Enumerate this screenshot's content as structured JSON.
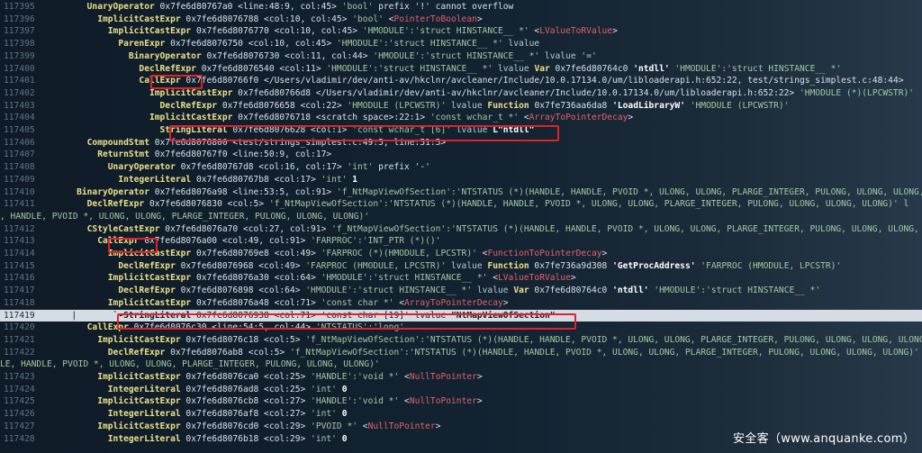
{
  "lines": [
    {
      "n": "117395",
      "segs": [
        [
          "      ",
          "tree"
        ],
        [
          "UnaryOperator",
          "yellow"
        ],
        [
          " 0x7fe6d80767a0 <line:48:9, col:45> ",
          "white"
        ],
        [
          "'bool'",
          "green"
        ],
        [
          " prefix '!' cannot overflow",
          "white"
        ]
      ]
    },
    {
      "n": "117396",
      "segs": [
        [
          "        ",
          "tree"
        ],
        [
          "ImplicitCastExpr",
          "yellow"
        ],
        [
          " 0x7fe6d8076788 <col:10, col:45> ",
          "white"
        ],
        [
          "'bool'",
          "green"
        ],
        [
          " <",
          "white"
        ],
        [
          "PointerToBoolean",
          "red"
        ],
        [
          ">",
          "white"
        ]
      ]
    },
    {
      "n": "117397",
      "segs": [
        [
          "          ",
          "tree"
        ],
        [
          "ImplicitCastExpr",
          "yellow"
        ],
        [
          " 0x7fe6d8076770 <col:10, col:45> ",
          "white"
        ],
        [
          "'HMODULE':'struct HINSTANCE__ *'",
          "green"
        ],
        [
          " <",
          "white"
        ],
        [
          "LValueToRValue",
          "red"
        ],
        [
          ">",
          "white"
        ]
      ]
    },
    {
      "n": "117398",
      "segs": [
        [
          "            ",
          "tree"
        ],
        [
          "ParenExpr",
          "yellow"
        ],
        [
          " 0x7fe6d8076750 <col:10, col:45> ",
          "white"
        ],
        [
          "'HMODULE':'struct HINSTANCE__ *'",
          "green"
        ],
        [
          " lvalue",
          "cyan"
        ]
      ]
    },
    {
      "n": "117399",
      "segs": [
        [
          "              ",
          "tree"
        ],
        [
          "BinaryOperator",
          "yellow"
        ],
        [
          " 0x7fe6d8076730 <col:11, col:44> ",
          "white"
        ],
        [
          "'HMODULE':'struct HINSTANCE__ *'",
          "green"
        ],
        [
          " lvalue '='",
          "cyan"
        ]
      ]
    },
    {
      "n": "117400",
      "segs": [
        [
          "                ",
          "tree"
        ],
        [
          "DeclRefExpr",
          "yellow"
        ],
        [
          " 0x7fe6d8076540 <col:11> ",
          "white"
        ],
        [
          "'HMODULE':'struct HINSTANCE__ *'",
          "green"
        ],
        [
          " lvalue ",
          "cyan"
        ],
        [
          "Var",
          "yellow"
        ],
        [
          " 0x7fe6d80764c0 ",
          "white"
        ],
        [
          "'ntdll'",
          "bwhite"
        ],
        [
          " 'HMODULE':'struct HINSTANCE__ *'",
          "green"
        ]
      ]
    },
    {
      "n": "117401",
      "segs": [
        [
          "                ",
          "tree"
        ],
        [
          "CallExpr",
          "yellow"
        ],
        [
          " 0x7fe6d80766f0 </Users/vladimir/dev/anti-av/hkclnr/avcleaner/Include/10.0.17134.0/um/libloaderapi.h:652:22, test/strings_simplest.c:48:44>",
          "white"
        ]
      ]
    },
    {
      "n": "117402",
      "segs": [
        [
          "                  ",
          "tree"
        ],
        [
          "ImplicitCastExpr",
          "yellow"
        ],
        [
          " 0x7fe6d80766d8 </Users/vladimir/dev/anti-av/hkclnr/avcleaner/Include/10.0.17134.0/um/libloaderapi.h:652:22> ",
          "white"
        ],
        [
          "'HMODULE (*)(LPCWSTR)'",
          "green"
        ]
      ]
    },
    {
      "n": "117403",
      "segs": [
        [
          "                    ",
          "tree"
        ],
        [
          "DeclRefExpr",
          "yellow"
        ],
        [
          " 0x7fe6d8076658 <col:22> ",
          "white"
        ],
        [
          "'HMODULE (LPCWSTR)'",
          "green"
        ],
        [
          " lvalue ",
          "cyan"
        ],
        [
          "Function",
          "yellow"
        ],
        [
          " 0x7fe736aa6da8 ",
          "white"
        ],
        [
          "'LoadLibraryW'",
          "bwhite"
        ],
        [
          " 'HMODULE (LPCWSTR)'",
          "green"
        ]
      ]
    },
    {
      "n": "117404",
      "segs": [
        [
          "                  ",
          "tree"
        ],
        [
          "ImplicitCastExpr",
          "yellow"
        ],
        [
          " 0x7fe6d8076718 <scratch space>:22:1> ",
          "white"
        ],
        [
          "'const wchar_t *'",
          "green"
        ],
        [
          " <",
          "white"
        ],
        [
          "ArrayToPointerDecay",
          "red"
        ],
        [
          ">",
          "white"
        ]
      ]
    },
    {
      "n": "117405",
      "segs": [
        [
          "                    ",
          "tree"
        ],
        [
          "StringLiteral",
          "yellow"
        ],
        [
          " 0x7fe6d8076628 <col:1> ",
          "white"
        ],
        [
          "'const wchar_t [6]'",
          "green"
        ],
        [
          " lvalue ",
          "cyan"
        ],
        [
          "L\"ntdll\"",
          "bwhite"
        ]
      ]
    },
    {
      "n": "117406",
      "segs": [
        [
          "      ",
          "tree"
        ],
        [
          "CompoundStmt",
          "yellow"
        ],
        [
          " 0x7fe6d8076800 <test/strings_simplest.c:49:5, line:51:5>",
          "white"
        ]
      ]
    },
    {
      "n": "117407",
      "segs": [
        [
          "        ",
          "tree"
        ],
        [
          "ReturnStmt",
          "yellow"
        ],
        [
          " 0x7fe6d80767f0 <line:50:9, col:17>",
          "white"
        ]
      ]
    },
    {
      "n": "117408",
      "segs": [
        [
          "          ",
          "tree"
        ],
        [
          "UnaryOperator",
          "yellow"
        ],
        [
          " 0x7fe6d80767d8 <col:16, col:17> ",
          "white"
        ],
        [
          "'int'",
          "green"
        ],
        [
          " prefix '-'",
          "white"
        ]
      ]
    },
    {
      "n": "117409",
      "segs": [
        [
          "            ",
          "tree"
        ],
        [
          "IntegerLiteral",
          "yellow"
        ],
        [
          " 0x7fe6d80767b8 <col:17> ",
          "white"
        ],
        [
          "'int'",
          "green"
        ],
        [
          " 1",
          "bwhite"
        ]
      ]
    },
    {
      "n": "117410",
      "segs": [
        [
          "    ",
          "tree"
        ],
        [
          "BinaryOperator",
          "yellow"
        ],
        [
          " 0x7fe6d8076a98 <line:53:5, col:91> ",
          "white"
        ],
        [
          "'f_NtMapViewOfSection':'NTSTATUS (*)(HANDLE, HANDLE, PVOID *, ULONG, ULONG, PLARGE_INTEGER, PULONG, ULONG, ULONG, ULONG)'",
          "green"
        ]
      ]
    },
    {
      "n": "117411",
      "segs": [
        [
          "      ",
          "tree"
        ],
        [
          "DeclRefExpr",
          "yellow"
        ],
        [
          " 0x7fe6d8076830 <col:5> ",
          "white"
        ],
        [
          "'f_NtMapViewOfSection':'NTSTATUS (*)(HANDLE, HANDLE, PVOID *, ULONG, ULONG, PLARGE_INTEGER, PULONG, ULONG, ULONG, ULONG)'",
          "green"
        ],
        [
          " l",
          "cyan"
        ]
      ]
    },
    {
      "n": "",
      "segs": [
        [
          ", HANDLE, PVOID *, ULONG, ULONG, PLARGE_INTEGER, PULONG, ULONG, ULONG)'",
          "green"
        ]
      ]
    },
    {
      "n": "117412",
      "segs": [
        [
          "      ",
          "tree"
        ],
        [
          "CStyleCastExpr",
          "yellow"
        ],
        [
          " 0x7fe6d8076a70 <col:27, col:91> ",
          "white"
        ],
        [
          "'f_NtMapViewOfSection':'NTSTATUS (*)(HANDLE, HANDLE, PVOID *, ULONG, ULONG, PLARGE_INTEGER, PULONG, ULONG, ULONG, ULONG)'",
          "green"
        ]
      ]
    },
    {
      "n": "117413",
      "segs": [
        [
          "        ",
          "tree"
        ],
        [
          "CallExpr",
          "yellow"
        ],
        [
          " 0x7fe6d8076a00 <col:49, col:91> ",
          "white"
        ],
        [
          "'FARPROC':'INT_PTR (*)()'",
          "green"
        ]
      ]
    },
    {
      "n": "117414",
      "segs": [
        [
          "          ",
          "tree"
        ],
        [
          "ImplicitCastExpr",
          "yellow"
        ],
        [
          " 0x7fe6d80769e8 <col:49> ",
          "white"
        ],
        [
          "'FARPROC (*)(HMODULE, LPCSTR)'",
          "green"
        ],
        [
          " <",
          "white"
        ],
        [
          "FunctionToPointerDecay",
          "red"
        ],
        [
          ">",
          "white"
        ]
      ]
    },
    {
      "n": "117415",
      "segs": [
        [
          "            ",
          "tree"
        ],
        [
          "DeclRefExpr",
          "yellow"
        ],
        [
          " 0x7fe6d8076968 <col:49> ",
          "white"
        ],
        [
          "'FARPROC (HMODULE, LPCSTR)'",
          "green"
        ],
        [
          " lvalue ",
          "cyan"
        ],
        [
          "Function",
          "yellow"
        ],
        [
          " 0x7fe736a9d308 ",
          "white"
        ],
        [
          "'GetProcAddress'",
          "bwhite"
        ],
        [
          " 'FARPROC (HMODULE, LPCSTR)'",
          "green"
        ]
      ]
    },
    {
      "n": "117416",
      "segs": [
        [
          "          ",
          "tree"
        ],
        [
          "ImplicitCastExpr",
          "yellow"
        ],
        [
          " 0x7fe6d8076a30 <col:64> ",
          "white"
        ],
        [
          "'HMODULE':'struct HINSTANCE__ *'",
          "green"
        ],
        [
          " <",
          "white"
        ],
        [
          "LValueToRValue",
          "red"
        ],
        [
          ">",
          "white"
        ]
      ]
    },
    {
      "n": "117417",
      "segs": [
        [
          "            ",
          "tree"
        ],
        [
          "DeclRefExpr",
          "yellow"
        ],
        [
          " 0x7fe6d8076898 <col:64> ",
          "white"
        ],
        [
          "'HMODULE':'struct HINSTANCE__ *'",
          "green"
        ],
        [
          " lvalue ",
          "cyan"
        ],
        [
          "Var",
          "yellow"
        ],
        [
          " 0x7fe6d80764c0 ",
          "white"
        ],
        [
          "'ntdll'",
          "bwhite"
        ],
        [
          " 'HMODULE':'struct HINSTANCE__ *'",
          "green"
        ]
      ]
    },
    {
      "n": "117418",
      "segs": [
        [
          "          ",
          "tree"
        ],
        [
          "ImplicitCastExpr",
          "yellow"
        ],
        [
          " 0x7fe6d8076a48 <col:71> ",
          "white"
        ],
        [
          "'const char *'",
          "green"
        ],
        [
          " <",
          "white"
        ],
        [
          "ArrayToPointerDecay",
          "red"
        ],
        [
          ">",
          "white"
        ]
      ]
    },
    {
      "n": "117419",
      "hl": true,
      "segs": [
        [
          "   |       ",
          "tree"
        ],
        [
          "`-StringLiteral",
          "yellow"
        ],
        [
          " 0x7fe6d8076938 <col:71> ",
          "white"
        ],
        [
          "'const char [19]'",
          "green"
        ],
        [
          " lvalue ",
          "cyan"
        ],
        [
          "\"NtMapViewOfSection\"",
          "bwhite"
        ]
      ]
    },
    {
      "n": "117420",
      "segs": [
        [
          "      ",
          "tree"
        ],
        [
          "CallExpr",
          "yellow"
        ],
        [
          " 0x7fe6d8076c30 <line:54:5, col:44> ",
          "white"
        ],
        [
          "'NTSTATUS':'long'",
          "green"
        ]
      ]
    },
    {
      "n": "117421",
      "segs": [
        [
          "        ",
          "tree"
        ],
        [
          "ImplicitCastExpr",
          "yellow"
        ],
        [
          " 0x7fe6d8076c18 <col:5> ",
          "white"
        ],
        [
          "'f_NtMapViewOfSection':'NTSTATUS (*)(HANDLE, HANDLE, PVOID *, ULONG, ULONG, PLARGE_INTEGER, PULONG, ULONG, ULONG, ULONG)'",
          "green"
        ]
      ]
    },
    {
      "n": "117422",
      "segs": [
        [
          "          ",
          "tree"
        ],
        [
          "DeclRefExpr",
          "yellow"
        ],
        [
          " 0x7fe6d8076ab8 <col:5> ",
          "white"
        ],
        [
          "'f_NtMapViewOfSection':'NTSTATUS (*)(HANDLE, HANDLE, PVOID *, ULONG, ULONG, PLARGE_INTEGER, PULONG, ULONG, ULONG, ULONG)'",
          "green"
        ]
      ]
    },
    {
      "n": "",
      "segs": [
        [
          "LE, HANDLE, PVOID *, ULONG, ULONG, PLARGE_INTEGER, PULONG, ULONG, ULONG)'",
          "green"
        ]
      ]
    },
    {
      "n": "117423",
      "segs": [
        [
          "        ",
          "tree"
        ],
        [
          "ImplicitCastExpr",
          "yellow"
        ],
        [
          " 0x7fe6d8076ca0 <col:25> ",
          "white"
        ],
        [
          "'HANDLE':'void *'",
          "green"
        ],
        [
          " <",
          "white"
        ],
        [
          "NullToPointer",
          "red"
        ],
        [
          ">",
          "white"
        ]
      ]
    },
    {
      "n": "117424",
      "segs": [
        [
          "          ",
          "tree"
        ],
        [
          "IntegerLiteral",
          "yellow"
        ],
        [
          " 0x7fe6d8076ad8 <col:25> ",
          "white"
        ],
        [
          "'int'",
          "green"
        ],
        [
          " 0",
          "bwhite"
        ]
      ]
    },
    {
      "n": "117425",
      "segs": [
        [
          "        ",
          "tree"
        ],
        [
          "ImplicitCastExpr",
          "yellow"
        ],
        [
          " 0x7fe6d8076cb8 <col:27> ",
          "white"
        ],
        [
          "'HANDLE':'void *'",
          "green"
        ],
        [
          " <",
          "white"
        ],
        [
          "NullToPointer",
          "red"
        ],
        [
          ">",
          "white"
        ]
      ]
    },
    {
      "n": "117426",
      "segs": [
        [
          "          ",
          "tree"
        ],
        [
          "IntegerLiteral",
          "yellow"
        ],
        [
          " 0x7fe6d8076af8 <col:27> ",
          "white"
        ],
        [
          "'int'",
          "green"
        ],
        [
          " 0",
          "bwhite"
        ]
      ]
    },
    {
      "n": "117427",
      "segs": [
        [
          "        ",
          "tree"
        ],
        [
          "ImplicitCastExpr",
          "yellow"
        ],
        [
          " 0x7fe6d8076cd0 <col:29> ",
          "white"
        ],
        [
          "'PVOID *'",
          "green"
        ],
        [
          " <",
          "white"
        ],
        [
          "NullToPointer",
          "red"
        ],
        [
          ">",
          "white"
        ]
      ]
    },
    {
      "n": "117428",
      "segs": [
        [
          "          ",
          "tree"
        ],
        [
          "IntegerLiteral",
          "yellow"
        ],
        [
          " 0x7fe6d8076b18 <col:29> ",
          "white"
        ],
        [
          "'int'",
          "green"
        ],
        [
          " 0",
          "bwhite"
        ]
      ]
    }
  ],
  "watermark": "安全客（www.anquanke.com）"
}
